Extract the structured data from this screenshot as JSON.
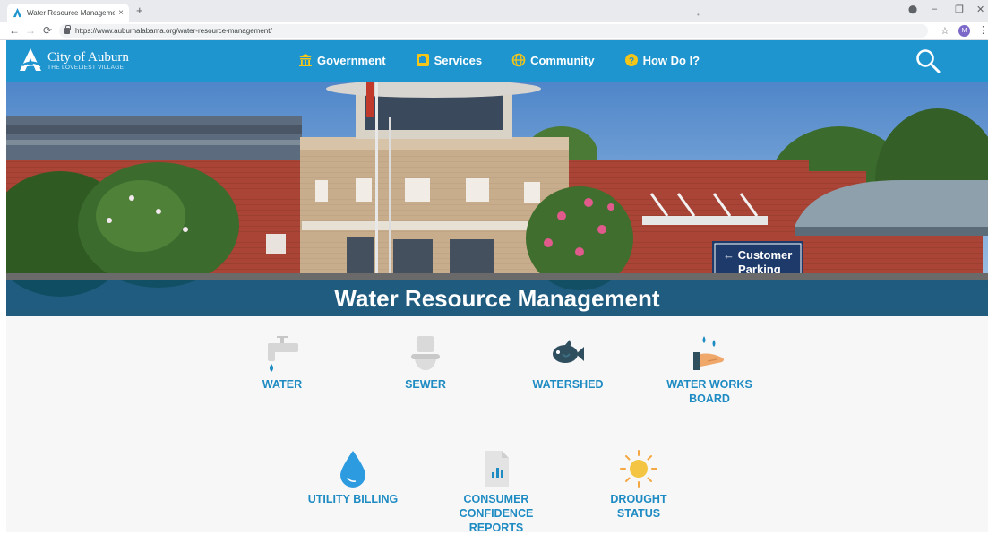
{
  "browser": {
    "tab_title": "Water Resource Management - ",
    "tab_close": "×",
    "new_tab": "+",
    "url": "https://www.auburnalabama.org/water-resource-management/",
    "profile_initial": "M",
    "icons": {
      "back": "back-arrow-icon",
      "forward": "forward-arrow-icon",
      "reload": "reload-icon",
      "lock": "lock-icon",
      "star": "star-icon",
      "menu": "kebab-menu-icon"
    }
  },
  "site": {
    "logo_name": "City of Auburn",
    "logo_tagline": "THE LOVELIEST VILLAGE",
    "nav": [
      {
        "label": "Government",
        "icon": "government-building-icon"
      },
      {
        "label": "Services",
        "icon": "services-icon"
      },
      {
        "label": "Community",
        "icon": "globe-icon"
      },
      {
        "label": "How Do I?",
        "icon": "question-icon"
      }
    ],
    "search_icon": "search-icon",
    "colors": {
      "header": "#1e95cf",
      "banner": "#0a4a6e",
      "link": "#1e8bc3"
    }
  },
  "hero": {
    "title": "Water Resource Management",
    "sign_line1": "← Customer",
    "sign_line2": "Parking"
  },
  "tiles": [
    {
      "label": "WATER",
      "icon": "water-faucet-icon"
    },
    {
      "label": "SEWER",
      "icon": "toilet-icon"
    },
    {
      "label": "WATERSHED",
      "icon": "fish-icon"
    },
    {
      "label_line1": "WATER WORKS",
      "label_line2": "BOARD",
      "icon": "hand-water-drops-icon"
    },
    {
      "label": "UTILITY BILLING",
      "icon": "water-drop-icon"
    },
    {
      "label_line1": "CONSUMER",
      "label_line2": "CONFIDENCE",
      "label_line3": "REPORTS",
      "icon": "report-document-icon"
    },
    {
      "label_line1": "DROUGHT",
      "label_line2": "STATUS",
      "icon": "sun-icon"
    }
  ]
}
